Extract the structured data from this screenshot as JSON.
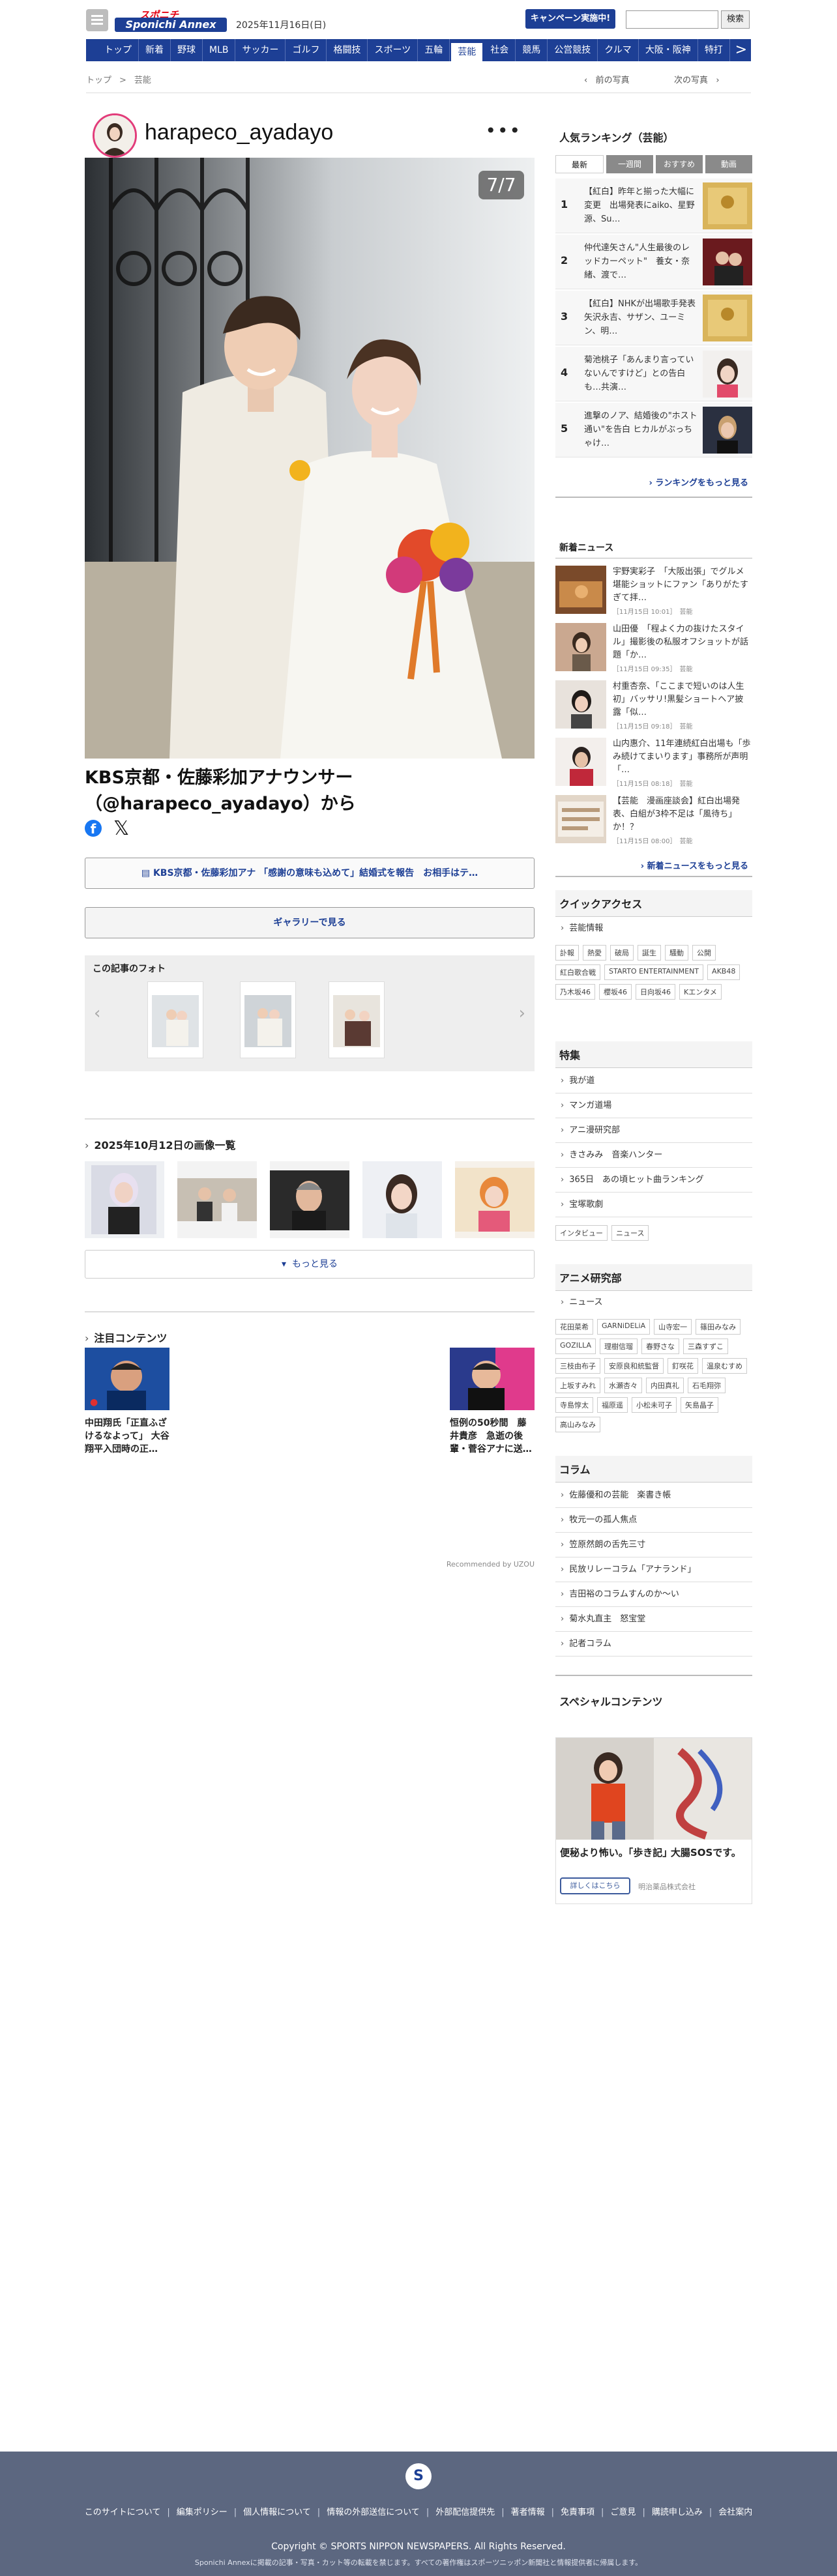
{
  "header": {
    "logo_top": "スポニチ",
    "logo_main": "Sponichi Annex",
    "date": "2025年11月16日(日)",
    "campaign_label": "キャンペーン実施中!",
    "search_button": "検索",
    "nav": [
      "トップ",
      "新着",
      "野球",
      "MLB",
      "サッカー",
      "ゴルフ",
      "格闘技",
      "スポーツ",
      "五輪",
      "芸能",
      "社会",
      "競馬",
      "公営競技",
      "クルマ",
      "大阪・阪神",
      "特打"
    ],
    "nav_active": "芸能",
    "nav_more": ">"
  },
  "breadcrumb": {
    "home": "トップ",
    "sep": ">",
    "current": "芸能"
  },
  "photo_nav": {
    "prev": "前の写真",
    "next": "次の写真"
  },
  "instagram": {
    "username": "harapeco_ayadayo",
    "more": "•••",
    "counter": "7/7"
  },
  "caption": "KBS京都・佐藤彩加アナウンサー（@harapeco_ayadayo）から",
  "related_link": "▤ KBS京都・佐藤彩加アナ 「感謝の意味も込めて」結婚式を報告　お相手はテ…",
  "gallery_button": "ギャラリーで見る",
  "article_photos": {
    "title": "この記事のフォト",
    "prev": "‹",
    "next": "›"
  },
  "date_gallery": {
    "title": "2025年10月12日の画像一覧",
    "more": "もっと見る"
  },
  "featured": {
    "title": "注目コンテンツ",
    "items": [
      {
        "text": "中田翔氏「正直ふざけるなよって」 大谷翔平入団時の正…"
      },
      {
        "text": "恒例の50秒間　藤井貴彦　急逝の後輩・菅谷アナに送…"
      }
    ],
    "recommended": "Recommended by UZOU"
  },
  "sidebar": {
    "ranking": {
      "title": "人気ランキング（芸能）",
      "tabs": [
        "最新",
        "一週間",
        "おすすめ",
        "動画"
      ],
      "items": [
        {
          "num": "1",
          "text": "【紅白】昨年と揃った大幅に変更　出場発表にaiko、星野源、Su…"
        },
        {
          "num": "2",
          "text": "仲代達矢さん\"人生最後のレッドカーペット\"　養女・奈緒、渡で…"
        },
        {
          "num": "3",
          "text": "【紅白】NHKが出場歌手発表　矢沢永吉、サザン、ユーミン、明…"
        },
        {
          "num": "4",
          "text": "菊池桃子「あんまり言っていないんですけど」との告白も…共演…"
        },
        {
          "num": "5",
          "text": "進撃のノア、結婚後の\"ホスト通い\"を告白 ヒカルがぶっちゃけ…"
        }
      ],
      "more": "› ランキングをもっと見る"
    },
    "news": {
      "title": "新着ニュース",
      "items": [
        {
          "text": "宇野実彩子　「大阪出張」でグルメ堪能ショットにファン「ありがたすぎて拝…",
          "meta": "［11月15日 10:01］　芸能"
        },
        {
          "text": "山田優　「程よく力の抜けたスタイル」撮影後の私服オフショットが話題「か…",
          "meta": "［11月15日 09:35］　芸能"
        },
        {
          "text": "村重杏奈、「ここまで短いのは人生初」バッサリ!黒髪ショートヘア披露「似…",
          "meta": "［11月15日 09:18］　芸能"
        },
        {
          "text": "山内惠介、11年連続紅白出場も「歩み続けてまいります」事務所が声明「…",
          "meta": "［11月15日 08:18］　芸能"
        },
        {
          "text": "【芸能　漫画座談会】紅白出場発表、白組が3枠不足は「風待ち」か！？",
          "meta": "［11月15日 08:00］　芸能"
        }
      ],
      "more": "› 新着ニュースをもっと見る"
    },
    "quick": {
      "title": "クイックアクセス",
      "link": "芸能情報",
      "tags": [
        "訃報",
        "熱愛",
        "破局",
        "誕生",
        "騒動",
        "公開",
        "紅白歌合戦",
        "STARTO ENTERTAINMENT",
        "AKB48",
        "乃木坂46",
        "櫻坂46",
        "日向坂46",
        "Kエンタメ"
      ]
    },
    "special": {
      "title": "特集",
      "links": [
        "我が道",
        "マンガ道場",
        "アニ漫研究部",
        "きさみみ　音楽ハンター",
        "365日　あの頃ヒット曲ランキング",
        "宝塚歌劇"
      ],
      "tags": [
        "インタビュー",
        "ニュース"
      ]
    },
    "anime": {
      "title": "アニメ研究部",
      "link": "ニュース",
      "tags": [
        "花田菜希",
        "GARNiDELiA",
        "山寺宏一",
        "篠田みなみ",
        "GOZILLA",
        "理樹信瑠",
        "春野さな",
        "三森すずこ",
        "三枝由布子",
        "安原良和統監督",
        "釘咲花",
        "温泉むすめ",
        "上坂すみれ",
        "水瀬杏々",
        "内田真礼",
        "石毛翔弥",
        "寺島惇太",
        "福原遥",
        "小松未可子",
        "矢島晶子",
        "高山みなみ"
      ]
    },
    "column": {
      "title": "コラム",
      "links": [
        "佐藤優和の芸能　楽書き帳",
        "牧元一の孤人焦点",
        "笠原然朗の舌先三寸",
        "民放リレーコラム「アナランド」",
        "吉田裕のコラムすんのか〜い",
        "菊水丸直主　怒宝堂",
        "記者コラム"
      ]
    },
    "special_contents": {
      "title": "スペシャルコンテンツ",
      "ad_text": "便秘より怖い。｢歩き記｣ 大腸SOSです。",
      "ad_button": "詳しくはこちら",
      "ad_sponsor": "明治薬品株式会社"
    }
  },
  "footer": {
    "logo": "S",
    "links": [
      "このサイトについて",
      "編集ポリシー",
      "個人情報について",
      "情報の外部送信について",
      "外部配信提供先",
      "著者情報",
      "免責事項",
      "ご意見",
      "購読申し込み",
      "会社案内"
    ],
    "copyright": "Copyright © SPORTS NIPPON NEWSPAPERS. All Rights Reserved.",
    "note": "Sponichi Annexに掲載の記事・写真・カット等の転載を禁じます。すべての著作権はスポーツニッポン新聞社と情報提供者に帰属します。"
  }
}
